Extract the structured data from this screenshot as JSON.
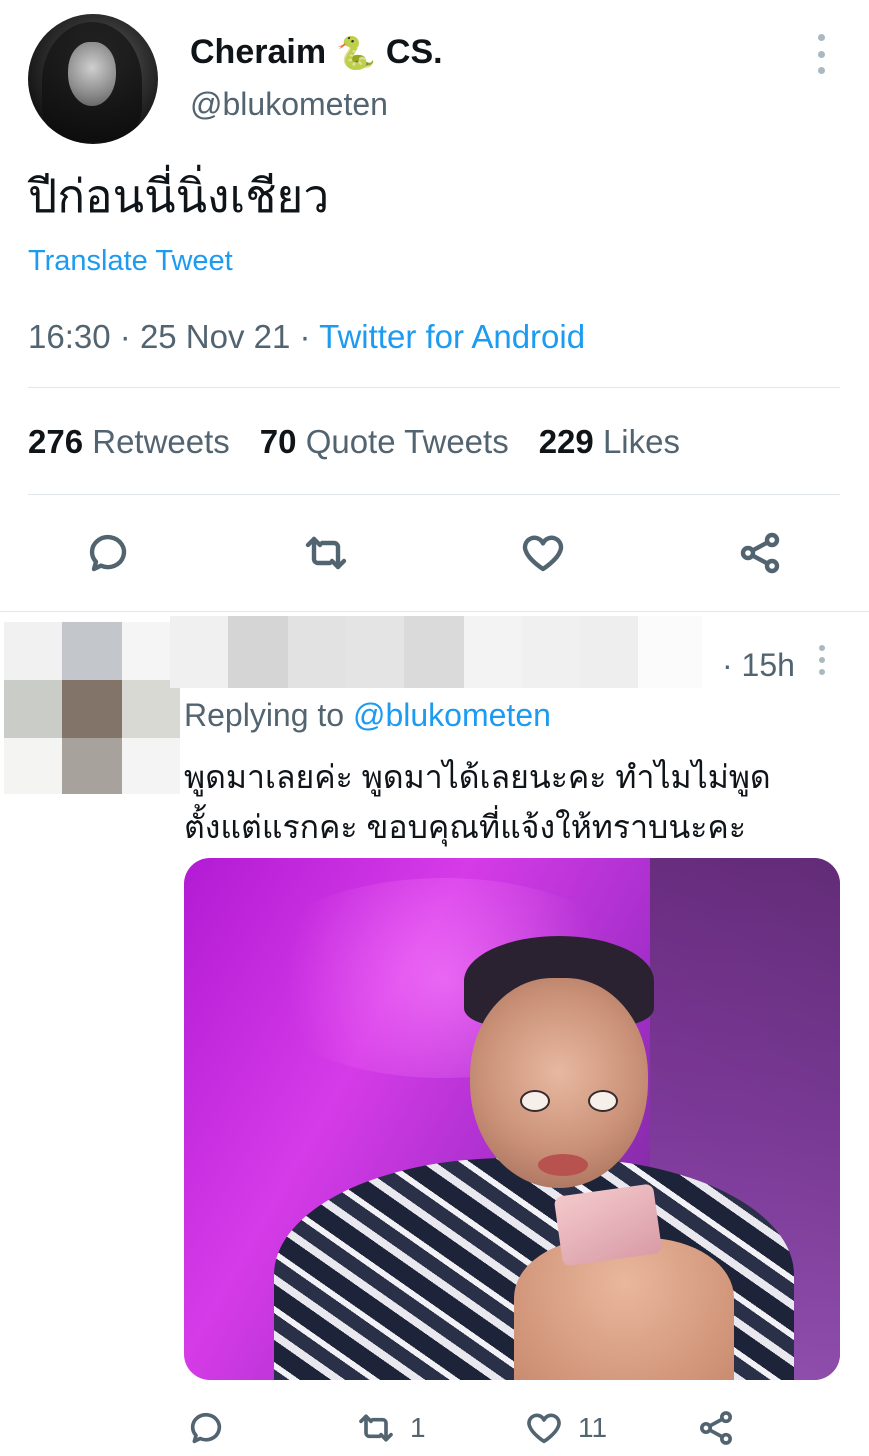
{
  "tweet": {
    "display_name": "Cheraim",
    "name_emoji": "🐍",
    "name_suffix": "CS.",
    "handle": "@blukometen",
    "text": "ปีก่อนนี่นิ่งเชียว",
    "translate_label": "Translate Tweet",
    "time": "16:30",
    "date": "25 Nov 21",
    "separator": "·",
    "source": "Twitter for Android",
    "stats": {
      "retweets_count": "276",
      "retweets_label": "Retweets",
      "quotes_count": "70",
      "quotes_label": "Quote Tweets",
      "likes_count": "229",
      "likes_label": "Likes"
    },
    "actions": [
      "reply-icon",
      "retweet-icon",
      "like-icon",
      "share-icon"
    ]
  },
  "reply": {
    "time": "15h",
    "time_prefix": "·",
    "replying_prefix": "Replying to",
    "replying_handle": "@blukometen",
    "text_line1": "พูดมาเลยค่ะ พูดมาได้เลยนะคะ ทำไมไม่พูด",
    "text_line2": "ตั้งแต่แรกคะ ขอบคุณที่แจ้งให้ทราบนะคะ",
    "retweet_count": "1",
    "like_count": "11",
    "actions": [
      "reply-icon",
      "retweet-icon",
      "like-icon",
      "share-icon"
    ]
  },
  "colors": {
    "link": "#1d9bf0",
    "secondary_text": "#536471",
    "primary_text": "#0f1419",
    "divider": "#e1e6ea"
  }
}
